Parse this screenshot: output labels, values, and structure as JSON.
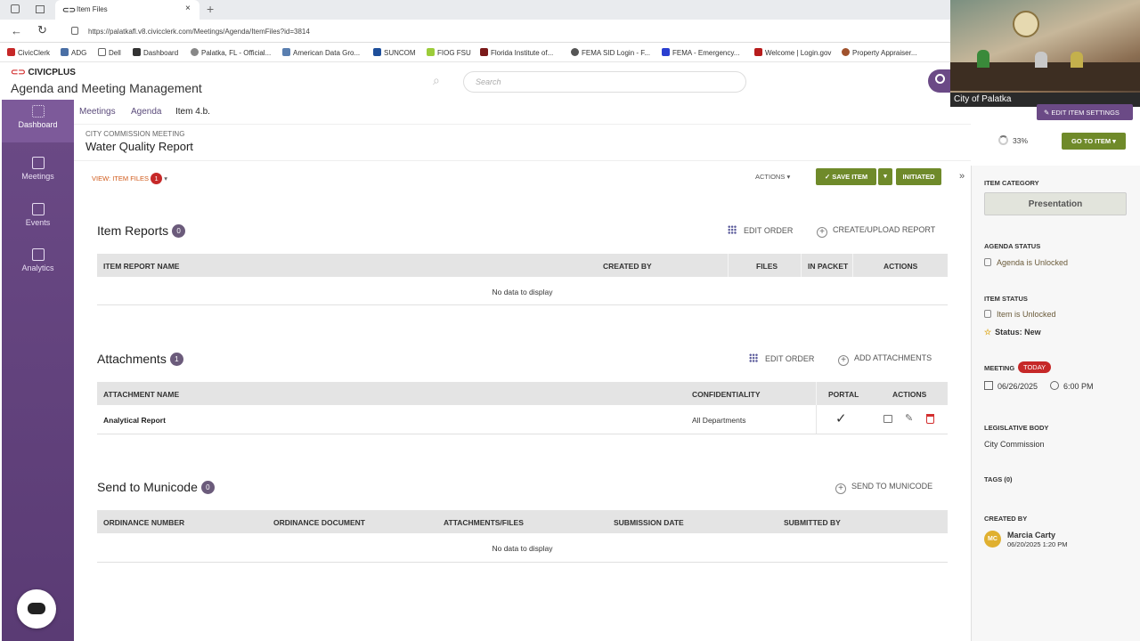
{
  "browser": {
    "tab_title": "Item Files",
    "url": "https://palatkafl.v8.civicclerk.com/Meetings/Agenda/ItemFiles?id=3814",
    "bookmarks": [
      "CivicClerk",
      "ADG",
      "Dell",
      "Dashboard",
      "Palatka, FL - Official...",
      "American Data Gro...",
      "SUNCOM",
      "FIOG FSU",
      "Florida Institute of...",
      "FEMA SID Login - F...",
      "FEMA - Emergency...",
      "Welcome | Login.gov",
      "Property Appraiser..."
    ]
  },
  "app": {
    "brand": "CIVICPLUS",
    "title": "Agenda and Meeting Management",
    "search_placeholder": "Search"
  },
  "sidebar": {
    "items": [
      {
        "label": "Dashboard",
        "icon": "dashboard-icon"
      },
      {
        "label": "Meetings",
        "icon": "meetings-icon"
      },
      {
        "label": "Events",
        "icon": "events-icon"
      },
      {
        "label": "Analytics",
        "icon": "analytics-icon"
      }
    ]
  },
  "breadcrumb": {
    "items": [
      "Meetings",
      "Agenda",
      "Item 4.b."
    ]
  },
  "item": {
    "meeting_type": "CITY COMMISSION MEETING",
    "title": "Water Quality Report",
    "progress": "33%",
    "progress_value": 0.33
  },
  "toolbar": {
    "view_item_files": "VIEW: ITEM FILES",
    "view_count": "1",
    "actions": "ACTIONS",
    "save_item": "SAVE ITEM",
    "initiated": "INITIATED",
    "edit_item_settings": "EDIT ITEM SETTINGS",
    "go_to_item": "GO TO ITEM"
  },
  "item_reports": {
    "title": "Item Reports",
    "count": "0",
    "edit_order": "EDIT ORDER",
    "create_upload": "CREATE/UPLOAD REPORT",
    "columns": [
      "ITEM REPORT NAME",
      "CREATED BY",
      "FILES",
      "IN PACKET",
      "ACTIONS"
    ],
    "empty": "No data to display"
  },
  "attachments": {
    "title": "Attachments",
    "count": "1",
    "edit_order": "EDIT ORDER",
    "add": "ADD ATTACHMENTS",
    "columns": [
      "ATTACHMENT NAME",
      "CONFIDENTIALITY",
      "PORTAL",
      "ACTIONS"
    ],
    "rows": [
      {
        "name": "Analytical Report",
        "confidentiality": "All Departments",
        "portal": "✓"
      }
    ]
  },
  "municode": {
    "title": "Send to Municode",
    "count": "0",
    "send": "SEND TO MUNICODE",
    "columns": [
      "ORDINANCE NUMBER",
      "ORDINANCE DOCUMENT",
      "ATTACHMENTS/FILES",
      "SUBMISSION DATE",
      "SUBMITTED BY"
    ],
    "empty": "No data to display"
  },
  "panel": {
    "item_category_label": "ITEM CATEGORY",
    "item_category": "Presentation",
    "agenda_status_label": "AGENDA STATUS",
    "agenda_status": "Agenda is Unlocked",
    "item_status_label": "ITEM STATUS",
    "item_status": "Item is Unlocked",
    "status": "Status: New",
    "meeting_label": "MEETING",
    "today": "TODAY",
    "meeting_date": "06/26/2025",
    "meeting_time": "6:00 PM",
    "legislative_label": "LEGISLATIVE BODY",
    "legislative": "City Commission",
    "tags": "TAGS (0)",
    "created_by_label": "CREATED BY",
    "creator_initials": "MC",
    "creator": "Marcia Carty",
    "created_date": "06/20/2025 1:20 PM"
  },
  "video": {
    "caption": "City of Palatka"
  },
  "colors": {
    "sidebar": "#5f3f7a",
    "accent_green": "#6f8a2a",
    "badge_red": "#c62828",
    "orange_link": "#d05a1a"
  }
}
